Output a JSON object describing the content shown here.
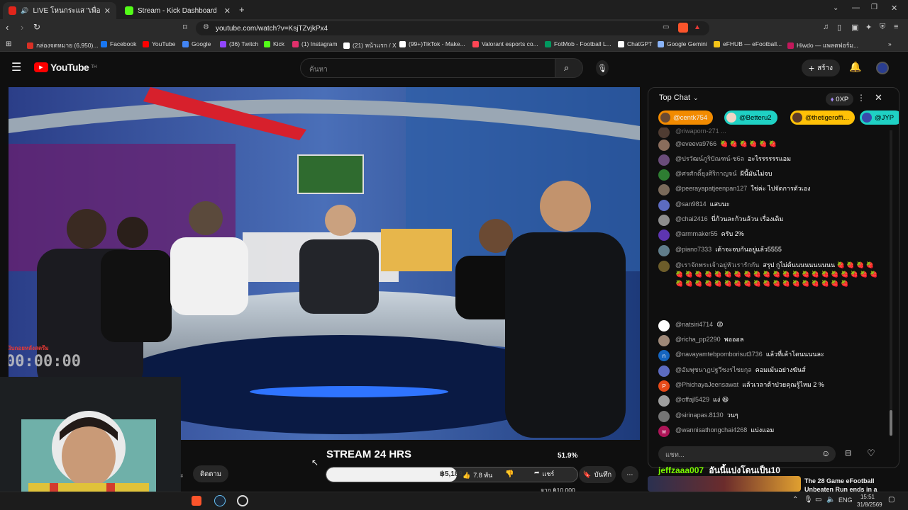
{
  "tabs": [
    {
      "label": "LIVE โหนกระแส \"เพื่อนๆรู้กัน่",
      "favicon_color": "#e1251b"
    },
    {
      "label": "Stream - Kick Dashboard",
      "favicon_color": "#53fc18"
    }
  ],
  "address": {
    "url": "youtube.com/watch?v=KsjTZvjkPx4"
  },
  "bookmarks": [
    {
      "label": "กล่องจดหมาย (6,950)...",
      "color": "#d93025"
    },
    {
      "label": "Facebook",
      "color": "#1877f2"
    },
    {
      "label": "YouTube",
      "color": "#ff0000"
    },
    {
      "label": "Google",
      "color": "#4285f4"
    },
    {
      "label": "(36) Twitch",
      "color": "#9146ff"
    },
    {
      "label": "Kick",
      "color": "#53fc18"
    },
    {
      "label": "(1) Instagram",
      "color": "#e1306c"
    },
    {
      "label": "(21) หน้าแรก / X",
      "color": "#ffffff"
    },
    {
      "label": "(99+)TikTok - Make...",
      "color": "#ffffff"
    },
    {
      "label": "Valorant esports co...",
      "color": "#ff4655"
    },
    {
      "label": "FotMob - Football L...",
      "color": "#00985f"
    },
    {
      "label": "ChatGPT",
      "color": "#ffffff"
    },
    {
      "label": "Google Gemini",
      "color": "#8ab4f8"
    },
    {
      "label": "eFHUB — eFootball...",
      "color": "#f5c518"
    },
    {
      "label": "Hiwdo — แพลตฟอร์ม...",
      "color": "#c2185b"
    }
  ],
  "youtube": {
    "logo_text": "YouTube",
    "logo_sup": "TH",
    "search_placeholder": "ค้นหา",
    "create_label": "สร้าง"
  },
  "chat": {
    "title": "Top Chat",
    "xp": "0XP",
    "pinned": [
      {
        "name": "@centk754",
        "bg": "#f28b00"
      },
      {
        "name": "@Betteru2",
        "bg": "#1fd1c4"
      },
      {
        "name": "@thetigeroffi...",
        "bg": "#ffc107"
      },
      {
        "name": "@JYP",
        "bg": "#1fd1c4"
      }
    ],
    "messages": [
      {
        "user": "@eveeva9766",
        "text": "🍓 🍓 🍓 🍓 🍓 🍓",
        "av": "#8a6d5c"
      },
      {
        "user": "@ปรวัฒน์ภูริปัณฑน์-ช6ล",
        "text": "อะไรรรรรรแอม",
        "av": "#6a4c7a"
      },
      {
        "user": "@ศรศักดิ์ยุงศิริกาญจน์",
        "text": "ผีนี้มันไม่จบ",
        "av": "#2e7d32"
      },
      {
        "user": "@peerayapatjeenpan127",
        "text": "ใช่ค่ะ ไปจัดการตัวเอง",
        "av": "#7a6a5a"
      },
      {
        "user": "@san9814",
        "text": "แสบนะ",
        "av": "#5c6bc0"
      },
      {
        "user": "@chai2416",
        "text": "นี่ก้วนละก้วนล้วน เรื่องเดิม",
        "av": "#8d8d8d"
      },
      {
        "user": "@armmaker55",
        "text": "ครับ 2%",
        "av": "#5e35b1"
      },
      {
        "user": "@piano7333",
        "text": "เต้าจะจบกันอยู่แล้ว5555",
        "av": "#607d8b"
      },
      {
        "user": "@เราจักพระเจ้าอยู่หัวเรารักกัน",
        "text": "สรุป กูไม่ต้นนนนนนนนนน 🍓 🍓 🍓 🍓 🍓 🍓 🍓 🍓 🍓 🍓 🍓 🍓 🍓 🍓 🍓 🍓 🍓 🍓 🍓 🍓 🍓 🍓 🍓 🍓 🍓 🍓 🍓 🍓 🍓 🍓 🍓 🍓 🍓 🍓 🍓 🍓 🍓 🍓 🍓 🍓 🍓 🍓 🍓",
        "av": "#6d5d2a"
      },
      {
        "user": "@natsiri4714",
        "text": "😡",
        "av": "#ffffff"
      },
      {
        "user": "@richa_pp2290",
        "text": "พอออล",
        "av": "#9e8878"
      },
      {
        "user": "@navayamtebpomborisut3736",
        "text": "แล้วที่เค้าโดนนนนละ",
        "av": "#1565c0",
        "initial": "n"
      },
      {
        "user": "@อัมพุชนาฏปฐวีชงรไชยกุล",
        "text": "คอมเม้นอย่างฆันส์",
        "av": "#5c6bc0"
      },
      {
        "user": "@PhichayaJeensawat",
        "text": "แล้วเวลาต้าป่วยคุณรู้ไหม 2 %",
        "av": "#e64a19",
        "initial": "P"
      },
      {
        "user": "@offajl5429",
        "text": "แง่ 😆",
        "av": "#9e9e9e"
      },
      {
        "user": "@sirinapas.8130",
        "text": "วนๆ",
        "av": "#757575"
      },
      {
        "user": "@wannisathongchai4268",
        "text": "แบ่งแอม",
        "av": "#ad1457",
        "initial": "w"
      }
    ],
    "input_placeholder": "แชท..."
  },
  "video": {
    "timer": "00:00:00",
    "timer_label": "นับถอยหลังสตรีม"
  },
  "below": {
    "stream_title": "STREAM 24 HRS",
    "goal_percent_label": "51.9%",
    "goal_fraction": 0.519,
    "goal_current": "฿5,189",
    "goal_target": "จาก ฿10,000",
    "follow_label": "ติดตาม",
    "likes": "7.8 พัน",
    "share_label": "แชร์",
    "save_label": "บันทึก",
    "donor_name": "jeffzaaa007",
    "donor_msg": "อันนี้แบ่งโดนเป็น10",
    "rec_title": "The 28 Game eFootball Unbeaten Run ends in a"
  },
  "taskbar": {
    "lang": "ENG",
    "time": "15:51",
    "date": "31/8/2569"
  }
}
